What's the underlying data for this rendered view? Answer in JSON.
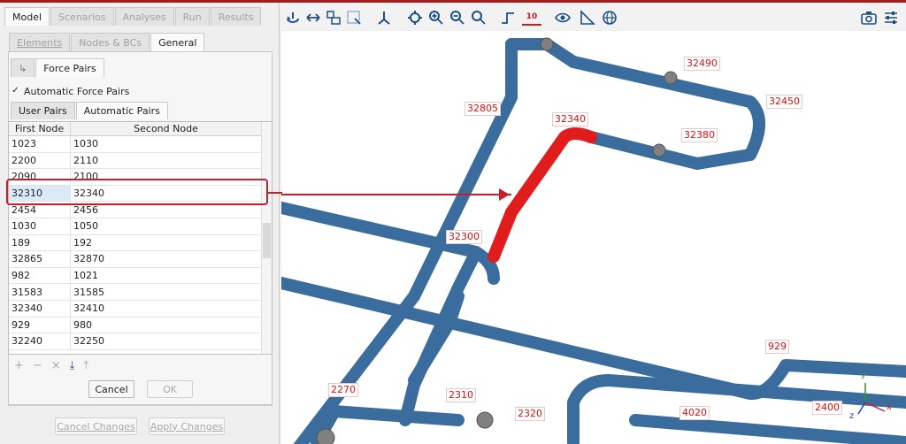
{
  "main_tabs": [
    "Model",
    "Scenarios",
    "Analyses",
    "Run",
    "Results"
  ],
  "sub_tabs": [
    "Elements",
    "Nodes & BCs",
    "General"
  ],
  "force_pairs_tab": "Force Pairs",
  "back_icon": "↳",
  "auto_force_pairs": {
    "label": "Automatic Force Pairs",
    "checked": "✓"
  },
  "pair_tabs": [
    "User Pairs",
    "Automatic Pairs"
  ],
  "table": {
    "headers": [
      "First Node",
      "Second Node"
    ],
    "rows": [
      [
        "1023",
        "1030"
      ],
      [
        "2200",
        "2110"
      ],
      [
        "2090",
        "2100"
      ],
      [
        "32310",
        "32340"
      ],
      [
        "2454",
        "2456"
      ],
      [
        "1030",
        "1050"
      ],
      [
        "189",
        "192"
      ],
      [
        "32865",
        "32870"
      ],
      [
        "982",
        "1021"
      ],
      [
        "31583",
        "31585"
      ],
      [
        "32340",
        "32410"
      ],
      [
        "929",
        "980"
      ],
      [
        "32240",
        "32250"
      ]
    ]
  },
  "table_tools": [
    "+",
    "−",
    "×",
    "⤓",
    "⤒"
  ],
  "buttons": {
    "cancel": "Cancel",
    "ok": "OK",
    "cancel_changes": "Cancel Changes",
    "apply_changes": "Apply Changes"
  },
  "toolbar_icons": [
    "rotate",
    "fit",
    "select-box",
    "zoom-box",
    "axes",
    "center",
    "zoom-in",
    "zoom-out",
    "zoom",
    "node",
    "label-size",
    "eye",
    "measure",
    "globe"
  ],
  "toolbar_label_size": "10",
  "axes": {
    "x": "x",
    "y": "y",
    "z": "z"
  },
  "node_labels": [
    "32490",
    "32450",
    "32805",
    "32340",
    "32380",
    "32300",
    "929",
    "2270",
    "2310",
    "2320",
    "4020",
    "2400"
  ],
  "colors": {
    "pipe": "#3a6d9e",
    "highlight": "#e11c1c",
    "callout": "#c8202a"
  }
}
